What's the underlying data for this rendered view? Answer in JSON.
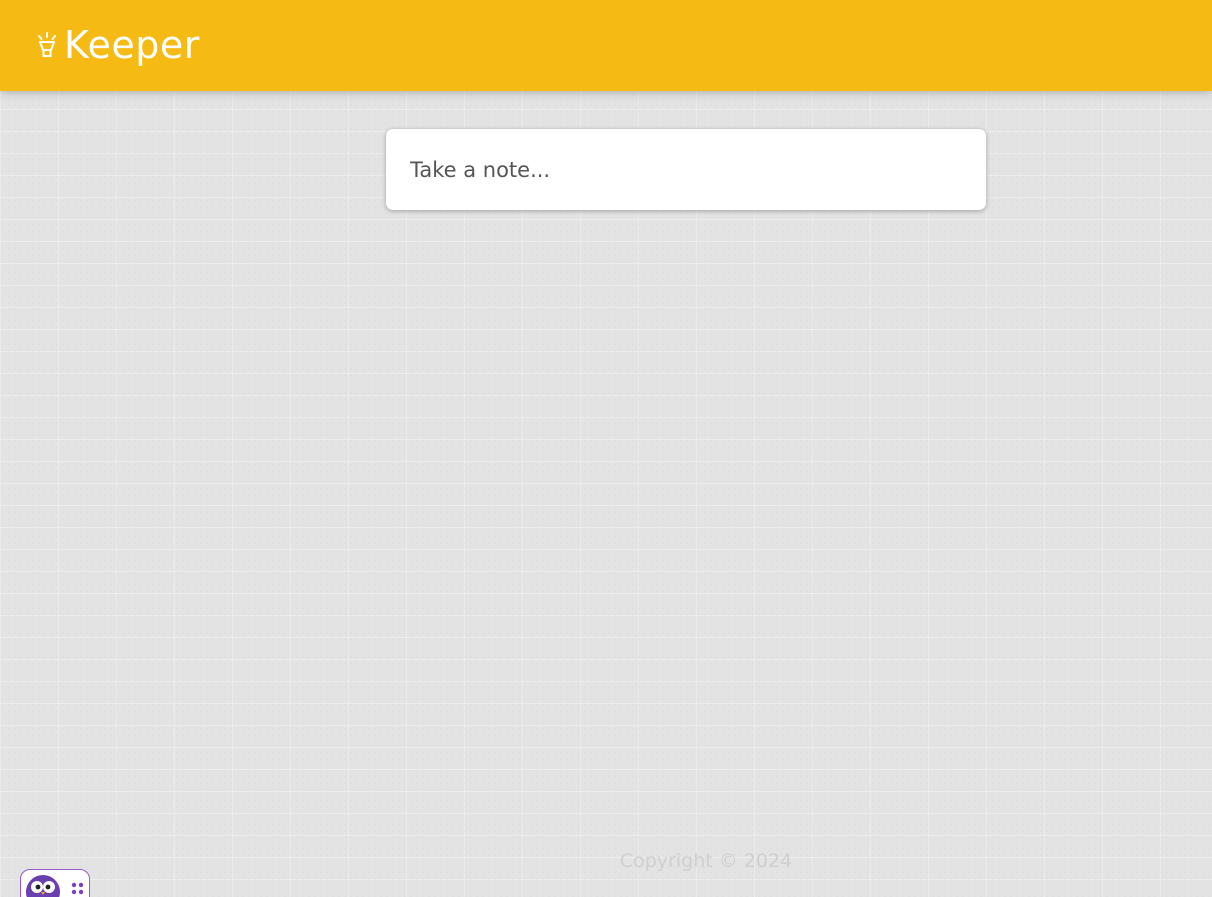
{
  "header": {
    "title": "Keeper",
    "logo_icon": "lamp-icon"
  },
  "note_form": {
    "placeholder": "Take a note..."
  },
  "footer": {
    "copyright": "Copyright © 2024"
  },
  "widget": {
    "icon": "owl-icon",
    "menu_icon": "dots-grid-icon"
  },
  "colors": {
    "header_bg": "#f5ba13",
    "page_bg": "#e3e3e3",
    "card_bg": "#ffffff",
    "footer_text": "#cfcfcf",
    "widget_accent": "#7b3fbf"
  }
}
